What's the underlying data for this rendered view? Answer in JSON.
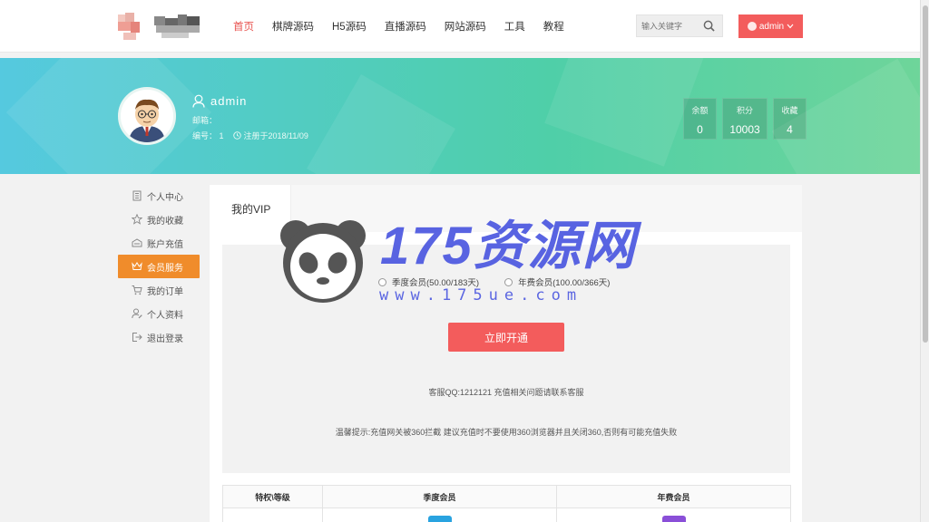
{
  "header": {
    "nav": [
      {
        "label": "首页",
        "active": true
      },
      {
        "label": "棋牌源码",
        "active": false
      },
      {
        "label": "H5源码",
        "active": false
      },
      {
        "label": "直播源码",
        "active": false
      },
      {
        "label": "网站源码",
        "active": false
      },
      {
        "label": "工具",
        "active": false
      },
      {
        "label": "教程",
        "active": false
      }
    ],
    "search_placeholder": "输入关键字",
    "user_label": "admin"
  },
  "profile": {
    "username": "admin",
    "email_label": "邮箱：",
    "id_text": "编号： 1",
    "registered_text": "注册于2018/11/09",
    "stats": [
      {
        "label": "余额",
        "value": "0"
      },
      {
        "label": "积分",
        "value": "10003"
      },
      {
        "label": "收藏",
        "value": "4"
      }
    ]
  },
  "sidebar": {
    "items": [
      {
        "label": "个人中心",
        "icon": "building-icon"
      },
      {
        "label": "我的收藏",
        "icon": "star-icon"
      },
      {
        "label": "账户充值",
        "icon": "wallet-icon"
      },
      {
        "label": "会员服务",
        "icon": "crown-icon",
        "active": true
      },
      {
        "label": "我的订单",
        "icon": "cart-icon"
      },
      {
        "label": "个人资料",
        "icon": "user-edit-icon"
      },
      {
        "label": "退出登录",
        "icon": "logout-icon"
      }
    ]
  },
  "main": {
    "tab_label": "我的VIP",
    "options": [
      "季度会员(50.00/183天)",
      "年费会员(100.00/366天)"
    ],
    "open_button": "立即开通",
    "qq_text": "客服QQ:1212121 充值相关问题请联系客服",
    "tip_text": "温馨提示:充值网关被360拦截 建议充值时不要使用360浏览器并且关闭360,否则有可能充值失败",
    "table_headers": [
      "特权\\等级",
      "季度会员",
      "年费会员"
    ]
  },
  "watermark": {
    "title": "175资源网",
    "url": "www.175ue.com"
  },
  "colors": {
    "accent_red": "#f35c5c",
    "active_orange": "#f08c2b",
    "banner_start": "#55c9df",
    "banner_end": "#6ed59a",
    "watermark_blue": "#4b57e0"
  }
}
